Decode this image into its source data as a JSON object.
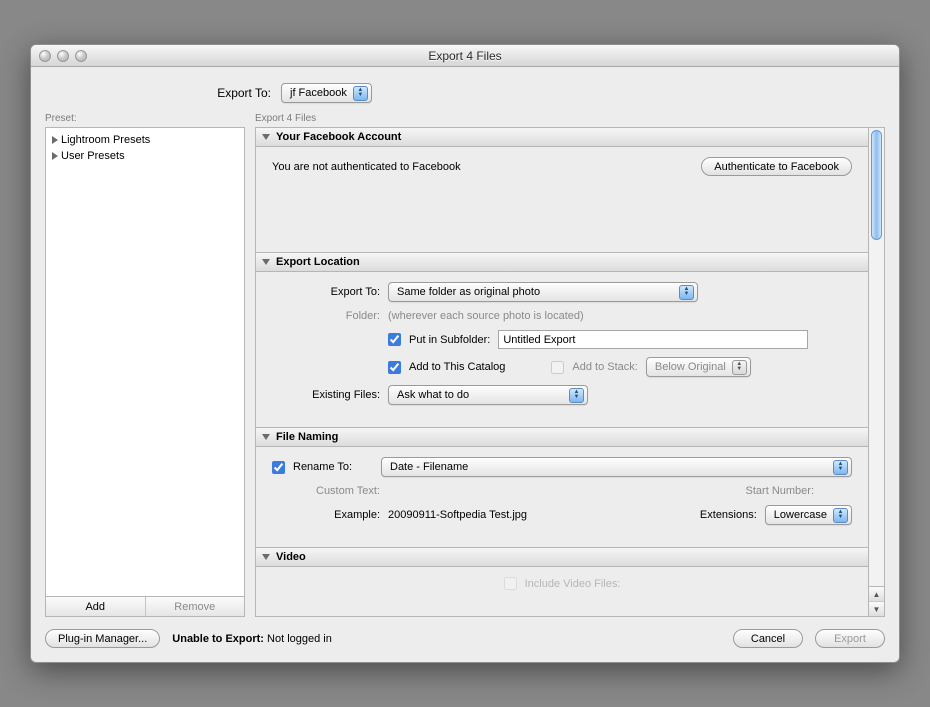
{
  "window": {
    "title": "Export 4 Files"
  },
  "export_to_label": "Export To:",
  "export_to_value": "jf Facebook",
  "preset_label": "Preset:",
  "main_label": "Export 4 Files",
  "presets": {
    "items": [
      "Lightroom Presets",
      "User Presets"
    ],
    "add": "Add",
    "remove": "Remove"
  },
  "sections": {
    "account": {
      "title": "Your Facebook Account",
      "msg": "You are not authenticated to Facebook",
      "btn": "Authenticate to Facebook"
    },
    "location": {
      "title": "Export Location",
      "export_to_label": "Export To:",
      "export_to_value": "Same folder as original photo",
      "folder_label": "Folder:",
      "folder_hint": "(wherever each source photo is located)",
      "subfolder_label": "Put in Subfolder:",
      "subfolder_value": "Untitled Export",
      "add_catalog": "Add to This Catalog",
      "add_stack": "Add to Stack:",
      "stack_value": "Below Original",
      "existing_label": "Existing Files:",
      "existing_value": "Ask what to do"
    },
    "naming": {
      "title": "File Naming",
      "rename_label": "Rename To:",
      "rename_value": "Date - Filename",
      "custom_text": "Custom Text:",
      "start_number": "Start Number:",
      "example_label": "Example:",
      "example_value": "20090911-Softpedia Test.jpg",
      "extensions_label": "Extensions:",
      "extensions_value": "Lowercase"
    },
    "video": {
      "title": "Video",
      "include": "Include Video Files:"
    }
  },
  "footer": {
    "plugin": "Plug-in Manager...",
    "status_label": "Unable to Export:",
    "status_value": "Not logged in",
    "cancel": "Cancel",
    "export": "Export"
  }
}
